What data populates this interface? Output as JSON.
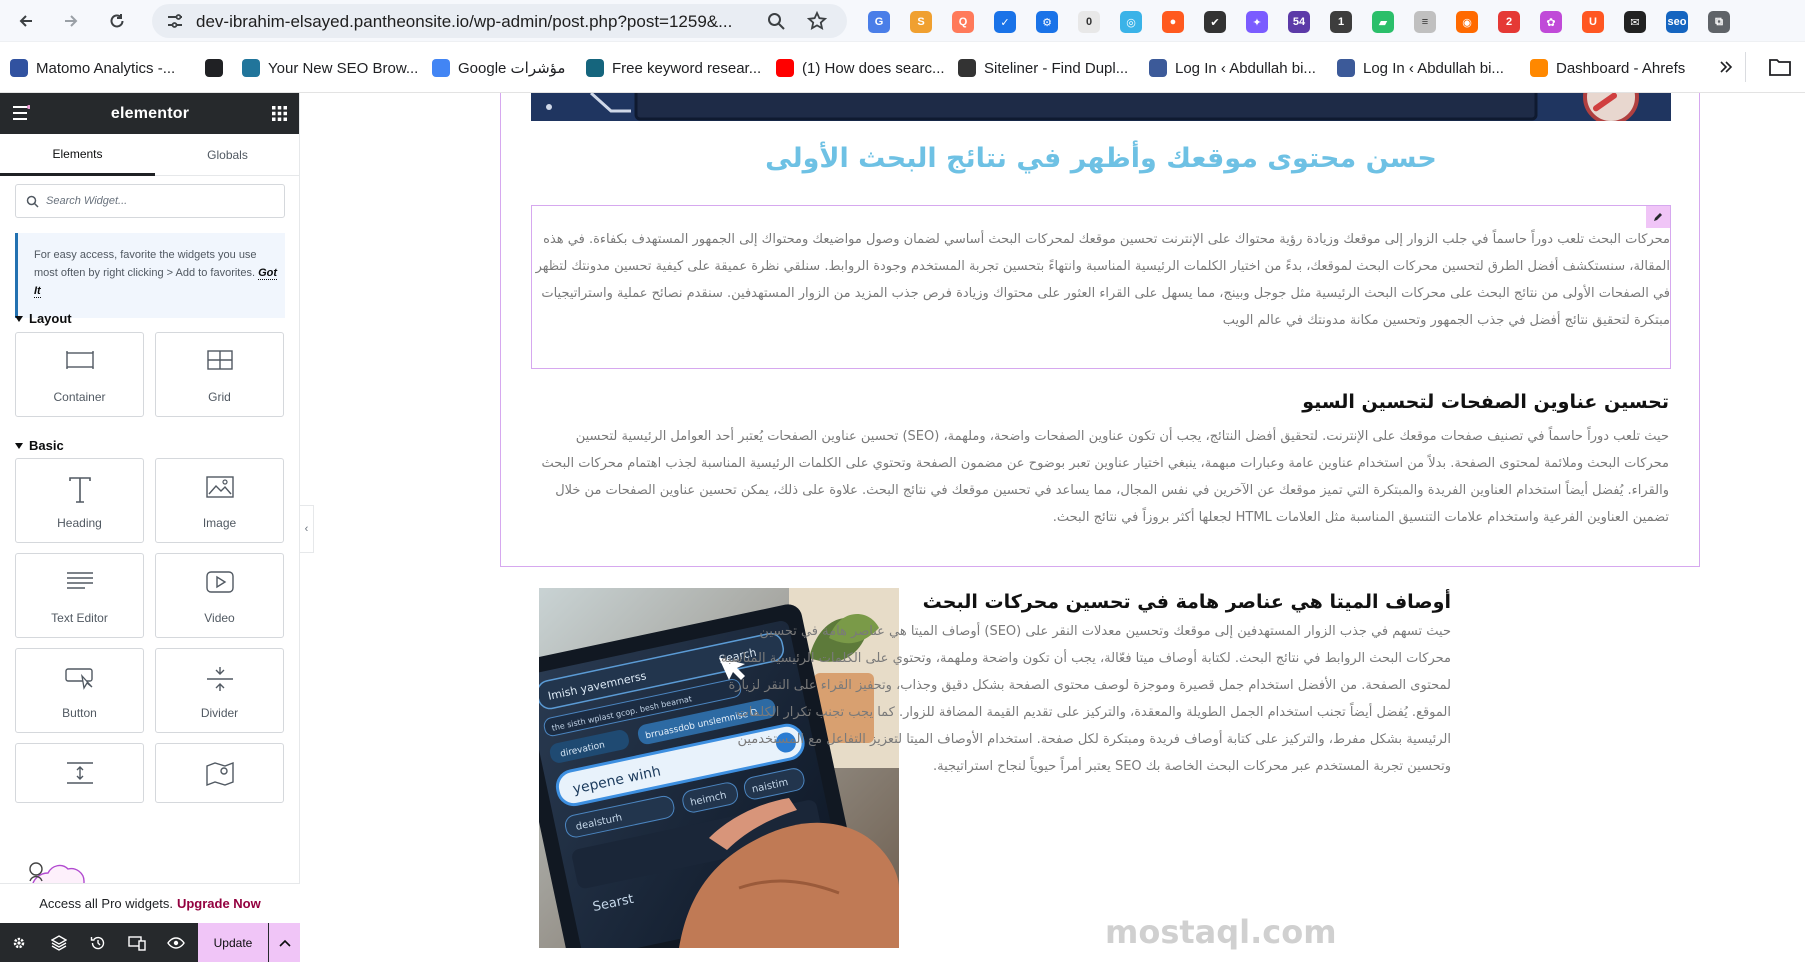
{
  "browser": {
    "url": "dev-ibrahim-elsayed.pantheonsite.io/wp-admin/post.php?post=1259&...",
    "extensions": [
      {
        "name": "translate-icon",
        "color": "#4a7ee8",
        "text": "G"
      },
      {
        "name": "seo-icon",
        "color": "#f0a030",
        "text": "S"
      },
      {
        "name": "screenshot-icon",
        "color": "#ff7a5a",
        "text": "Q"
      },
      {
        "name": "check-icon",
        "color": "#1a73e8",
        "text": "✓"
      },
      {
        "name": "gear-blue-icon",
        "color": "#1a73e8",
        "text": "⚙"
      },
      {
        "name": "speed-icon",
        "color": "#e8e8e8",
        "text": "0"
      },
      {
        "name": "globe-blue-icon",
        "color": "#3ab3e8",
        "text": "◎"
      },
      {
        "name": "reddit-icon",
        "color": "#ff5a1f",
        "text": "●"
      },
      {
        "name": "task-icon",
        "color": "#333333",
        "text": "✔"
      },
      {
        "name": "sparkle-icon",
        "color": "#7b5cff",
        "text": "✦"
      },
      {
        "name": "cap-icon",
        "color": "#5c3aa8",
        "text": "54"
      },
      {
        "name": "one-icon",
        "color": "#3d3d3d",
        "text": "1"
      },
      {
        "name": "pen-green-icon",
        "color": "#2bbf6a",
        "text": "▰"
      },
      {
        "name": "stack-icon",
        "color": "#c0c0c0",
        "text": "≡"
      },
      {
        "name": "globe-orange-icon",
        "color": "#ff6a00",
        "text": "◉"
      },
      {
        "name": "apps-icon",
        "color": "#e53935",
        "text": "2"
      },
      {
        "name": "brain-icon",
        "color": "#c04ad8",
        "text": "✿"
      },
      {
        "name": "u-icon",
        "color": "#ff5722",
        "text": "U"
      },
      {
        "name": "mail-icon",
        "color": "#222222",
        "text": "✉"
      },
      {
        "name": "seo-blue-icon",
        "color": "#1565c0",
        "text": "seo"
      },
      {
        "name": "puzzle-icon",
        "color": "#5f6368",
        "text": "⧉"
      }
    ]
  },
  "bookmarks": [
    {
      "label": "Matomo Analytics -...",
      "icon": "matomo-icon",
      "color": "#3152a0"
    },
    {
      "label": "",
      "icon": "openai-icon",
      "color": "#202124"
    },
    {
      "label": "Your New SEO Brow...",
      "icon": "wordpress-icon",
      "color": "#21759b"
    },
    {
      "label": "Google مؤشرات",
      "icon": "trends-icon",
      "color": "#4285f4"
    },
    {
      "label": "Free keyword resear...",
      "icon": "keyword-icon",
      "color": "#15657d"
    },
    {
      "label": "(1) How does searc...",
      "icon": "youtube-icon",
      "color": "#ff0000"
    },
    {
      "label": "Siteliner - Find Dupl...",
      "icon": "siteliner-icon",
      "color": "#333333"
    },
    {
      "label": "Log In ‹ Abdullah bi...",
      "icon": "login-icon",
      "color": "#3c5a99"
    },
    {
      "label": "Log In ‹ Abdullah bi...",
      "icon": "login-icon",
      "color": "#3c5a99"
    },
    {
      "label": "Dashboard - Ahrefs",
      "icon": "ahrefs-icon",
      "color": "#ff8800"
    }
  ],
  "panel": {
    "title": "elementor",
    "tabs": [
      "Elements",
      "Globals"
    ],
    "search_placeholder": "Search Widget...",
    "tip": "For easy access, favorite the widgets you use most often by right clicking > Add to favorites.",
    "tip_link": "Got It",
    "layout_title": "Layout",
    "basic_title": "Basic",
    "layout_widgets": [
      "Container",
      "Grid"
    ],
    "basic_widgets": [
      "Heading",
      "Image",
      "Text Editor",
      "Video",
      "Button",
      "Divider",
      "",
      "Google Maps"
    ],
    "pro_text": "Access all Pro widgets.",
    "pro_link": "Upgrade Now",
    "update_label": "Update"
  },
  "content": {
    "main_heading": "حسن محتوى موقعك وأظهر في نتائج البحث الأولى",
    "intro": "محركات البحث تلعب دوراً حاسماً في جلب الزوار إلى موقعك وزيادة رؤية محتواك على الإنترنت تحسين موقعك لمحركات البحث أساسي لضمان وصول مواضيعك ومحتواك إلى الجمهور المستهدف بكفاءة. في هذه المقالة، سنستكشف أفضل الطرق لتحسين محركات البحث لموقعك، بدءً من اختيار الكلمات الرئيسية المناسبة وانتهاءً بتحسين تجربة المستخدم وجودة الروابط. سنلقي نظرة عميقة على كيفية تحسين مدونتك لتظهر في الصفحات الأولى من نتائج البحث على محركات البحث الرئيسية مثل جوجل وبينج، مما يسهل على القراء العثور على محتواك وزيادة فرص جذب المزيد من الزوار المستهدفين. سنقدم نصائح عملية واستراتيجيات مبتكرة لتحقيق نتائج أفضل في جذب الجمهور وتحسين مكانة مدونتك في عالم الويب",
    "section2_heading": "تحسين عناوين الصفحات لتحسين السيو",
    "section2_body": "حيث تلعب دوراً حاسماً في تصنيف صفحات موقعك على الإنترنت. لتحقيق أفضل النتائج، يجب أن تكون عناوين الصفحات واضحة، وملهمة، (SEO) تحسين عناوين الصفحات يُعتبر أحد العوامل الرئيسية لتحسين محركات البحث وملائمة لمحتوى الصفحة. بدلاً من استخدام عناوين عامة وعبارات مبهمة، ينبغي اختيار عناوين تعبر بوضوح عن مضمون الصفحة وتحتوي على الكلمات الرئيسية المناسبة لجذب اهتمام محركات البحث والقراء. يُفضل أيضاً استخدام العناوين الفريدة والمبتكرة التي تميز موقعك عن الآخرين في نفس المجال، مما يساعد في تحسين موقعك في نتائج البحث. علاوة على ذلك، يمكن تحسين عناوين الصفحات من خلال تضمين العناوين الفرعية واستخدام علامات التنسيق المناسبة مثل العلامات HTML لجعلها أكثر بروزاً في نتائج البحث.",
    "section3_heading": "أوصاف الميتا هي عناصر هامة في تحسين محركات البحث",
    "section3_body": "حيث تسهم في جذب الزوار المستهدفين إلى موقعك وتحسين معدلات النقر على (SEO) أوصاف الميتا هي عناصر هامة في تحسين محركات البحث الروابط في نتائج البحث. لكتابة أوصاف ميتا فعّالة، يجب أن تكون واضحة وملهمة، وتحتوي على الكلمات الرئيسية المناسبة لمحتوى الصفحة. من الأفضل استخدام جمل قصيرة وموجزة لوصف محتوى الصفحة بشكل دقيق وجذاب، وتحفيز القراء على النقر لزيارة الموقع. يُفضل أيضاً تجنب استخدام الجمل الطويلة والمعقدة، والتركيز على تقديم القيمة المضافة للزوار. كما يجب تجنب تكرار الكلمات الرئيسية بشكل مفرط، والتركيز على كتابة أوصاف فريدة ومبتكرة لكل صفحة. استخدام الأوصاف الميتا لتعزيز التفاعل مع المستخدمين وتحسين تجربة المستخدم عبر محركات البحث الخاصة بك SEO يعتبر أمراً حيوياً لنجاح استراتيجية.",
    "photo_texts": [
      "Search",
      "Imish yavemnerss",
      "the sisth wplast gcop. besh bearnat",
      "direvation",
      "brruassdob unslemnise D",
      "yepene winh",
      "heimch",
      "naistim",
      "dealsturh",
      "Searst"
    ],
    "watermark": "mostaql.com"
  }
}
